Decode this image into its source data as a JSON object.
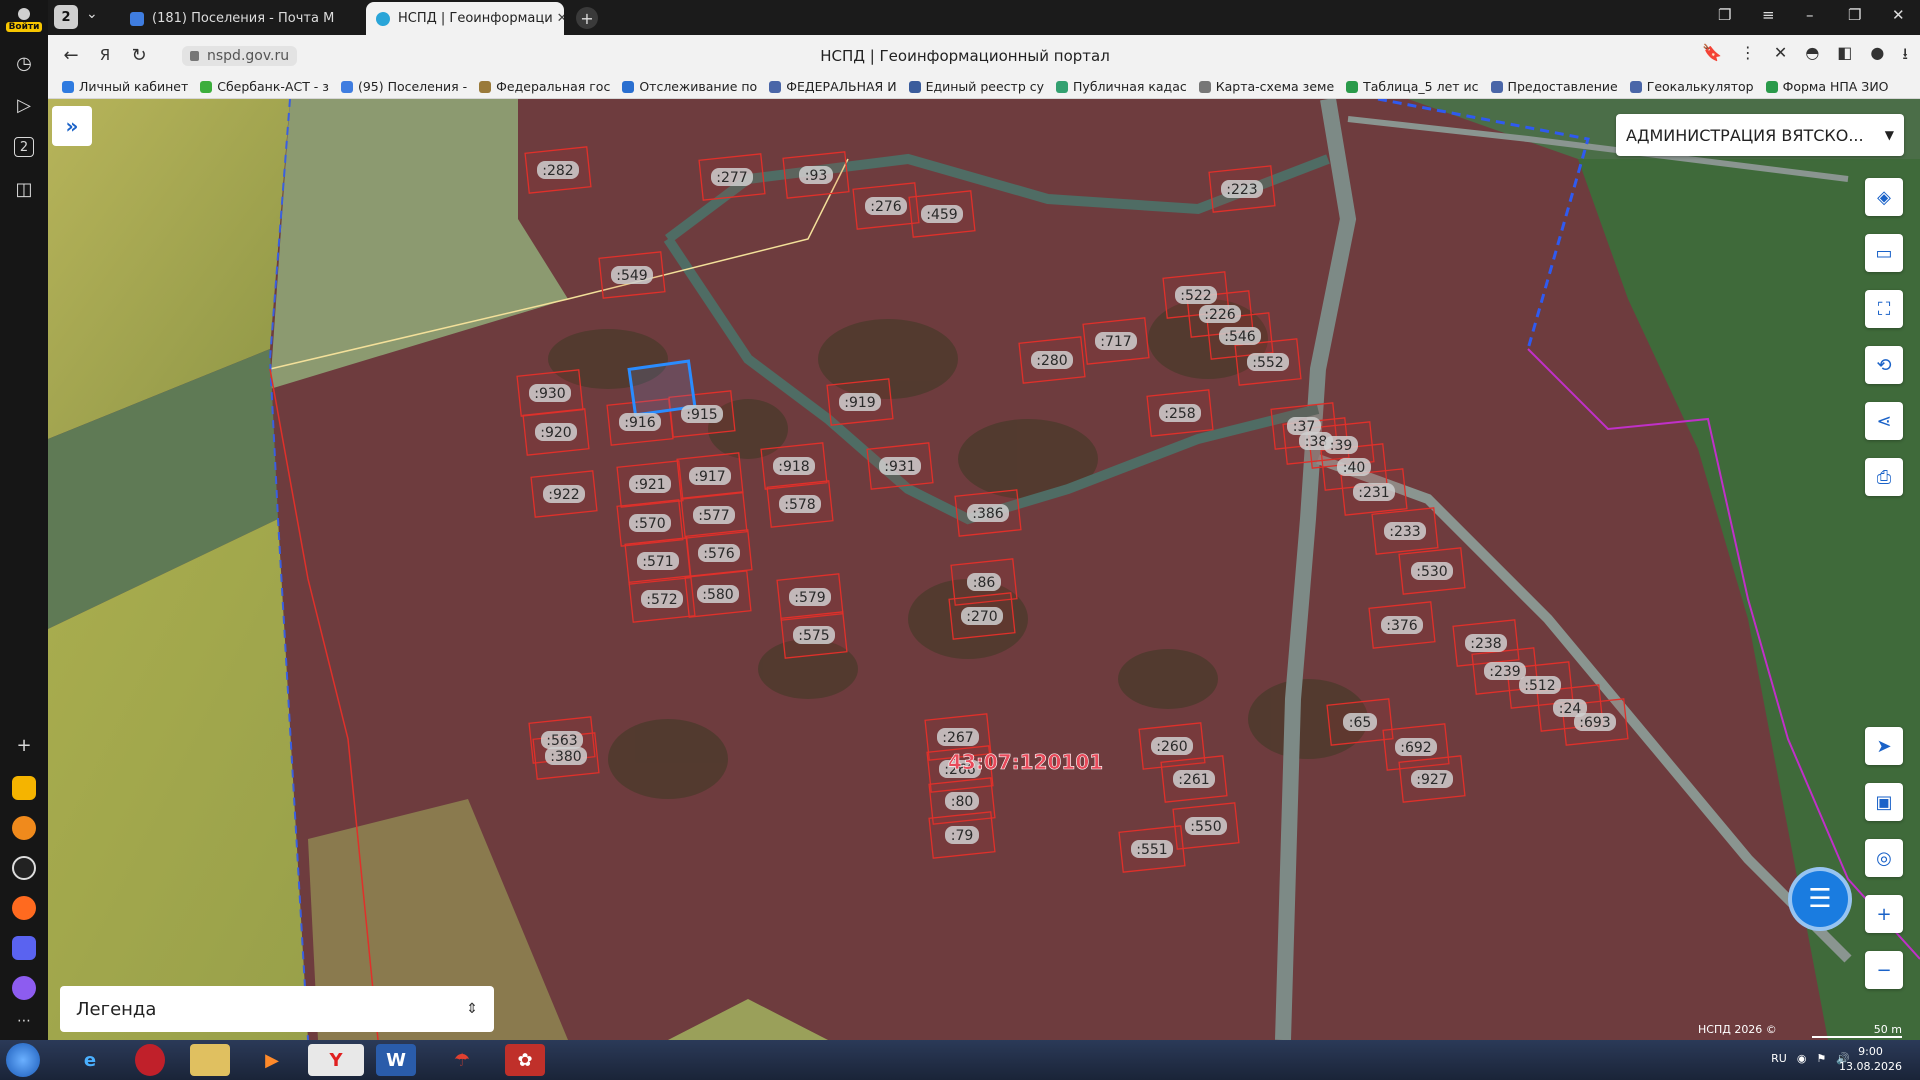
{
  "sidebar": {
    "login_label": "Войти",
    "tab_groups_count": "2"
  },
  "tabs": {
    "count": "2",
    "items": [
      {
        "title": "(181) Поселения - Почта М",
        "favicon_color": "#3f7de0"
      },
      {
        "title": "НСПД | Геоинформаци",
        "favicon_color": "#2aa5d8"
      }
    ],
    "close_glyph": "✕"
  },
  "address": {
    "url": "nspd.gov.ru",
    "title": "НСПД | Геоинформационный портал"
  },
  "bookmarks": [
    {
      "label": "Личный кабинет",
      "color": "#2f7be0"
    },
    {
      "label": "Сбербанк-АСТ - з",
      "color": "#3cae3c"
    },
    {
      "label": "(95) Поселения -",
      "color": "#3f7de0"
    },
    {
      "label": "Федеральная гос",
      "color": "#9a7a3a"
    },
    {
      "label": "Отслеживание по",
      "color": "#2a6fd0"
    },
    {
      "label": "ФЕДЕРАЛЬНАЯ И",
      "color": "#4a66a8"
    },
    {
      "label": "Единый реестр су",
      "color": "#3a5c9c"
    },
    {
      "label": "Публичная кадас",
      "color": "#33a070"
    },
    {
      "label": "Карта-схема земе",
      "color": "#777777"
    },
    {
      "label": "Таблица_5 лет ис",
      "color": "#2a9a4a"
    },
    {
      "label": "Предоставление",
      "color": "#4a66a8"
    },
    {
      "label": "Геокалькулятор",
      "color": "#4a66a8"
    },
    {
      "label": "Форма НПА ЗИО",
      "color": "#2a9a4a"
    }
  ],
  "map": {
    "org_select": "АДМИНИСТРАЦИЯ ВЯТСКО...",
    "quarter_label": "43:07:120101",
    "legend_label": "Легенда",
    "attribution": "НСПД 2026 ©",
    "scale": "50 m",
    "plots": [
      {
        "label": ":282"
      },
      {
        "label": ":277"
      },
      {
        "label": ":93"
      },
      {
        "label": ":276"
      },
      {
        "label": ":459"
      },
      {
        "label": ":223"
      },
      {
        "label": ":549"
      },
      {
        "label": ":522"
      },
      {
        "label": ":226"
      },
      {
        "label": ":546"
      },
      {
        "label": ":552"
      },
      {
        "label": ":717"
      },
      {
        "label": ":280"
      },
      {
        "label": ":930"
      },
      {
        "label": ":916"
      },
      {
        "label": ":915"
      },
      {
        "label": ":919"
      },
      {
        "label": ":258"
      },
      {
        "label": ":920"
      },
      {
        "label": ":37"
      },
      {
        "label": ":38"
      },
      {
        "label": ":39"
      },
      {
        "label": ":40"
      },
      {
        "label": ":921"
      },
      {
        "label": ":917"
      },
      {
        "label": ":918"
      },
      {
        "label": ":931"
      },
      {
        "label": ":922"
      },
      {
        "label": ":578"
      },
      {
        "label": ":231"
      },
      {
        "label": ":570"
      },
      {
        "label": ":577"
      },
      {
        "label": ":386"
      },
      {
        "label": ":233"
      },
      {
        "label": ":571"
      },
      {
        "label": ":576"
      },
      {
        "label": ":530"
      },
      {
        "label": ":572"
      },
      {
        "label": ":580"
      },
      {
        "label": ":579"
      },
      {
        "label": ":86"
      },
      {
        "label": ":270"
      },
      {
        "label": ":575"
      },
      {
        "label": ":376"
      },
      {
        "label": ":238"
      },
      {
        "label": ":239"
      },
      {
        "label": ":512"
      },
      {
        "label": ":563"
      },
      {
        "label": ":380"
      },
      {
        "label": ":267"
      },
      {
        "label": ":260"
      },
      {
        "label": ":65"
      },
      {
        "label": ":692"
      },
      {
        "label": ":693"
      },
      {
        "label": ":266"
      },
      {
        "label": ":261"
      },
      {
        "label": ":927"
      },
      {
        "label": ":80"
      },
      {
        "label": ":550"
      },
      {
        "label": ":79"
      },
      {
        "label": ":551"
      },
      {
        "label": ":24"
      }
    ]
  },
  "taskbar": {
    "lang": "RU",
    "time": "9:00",
    "date": "13.08.2026"
  }
}
